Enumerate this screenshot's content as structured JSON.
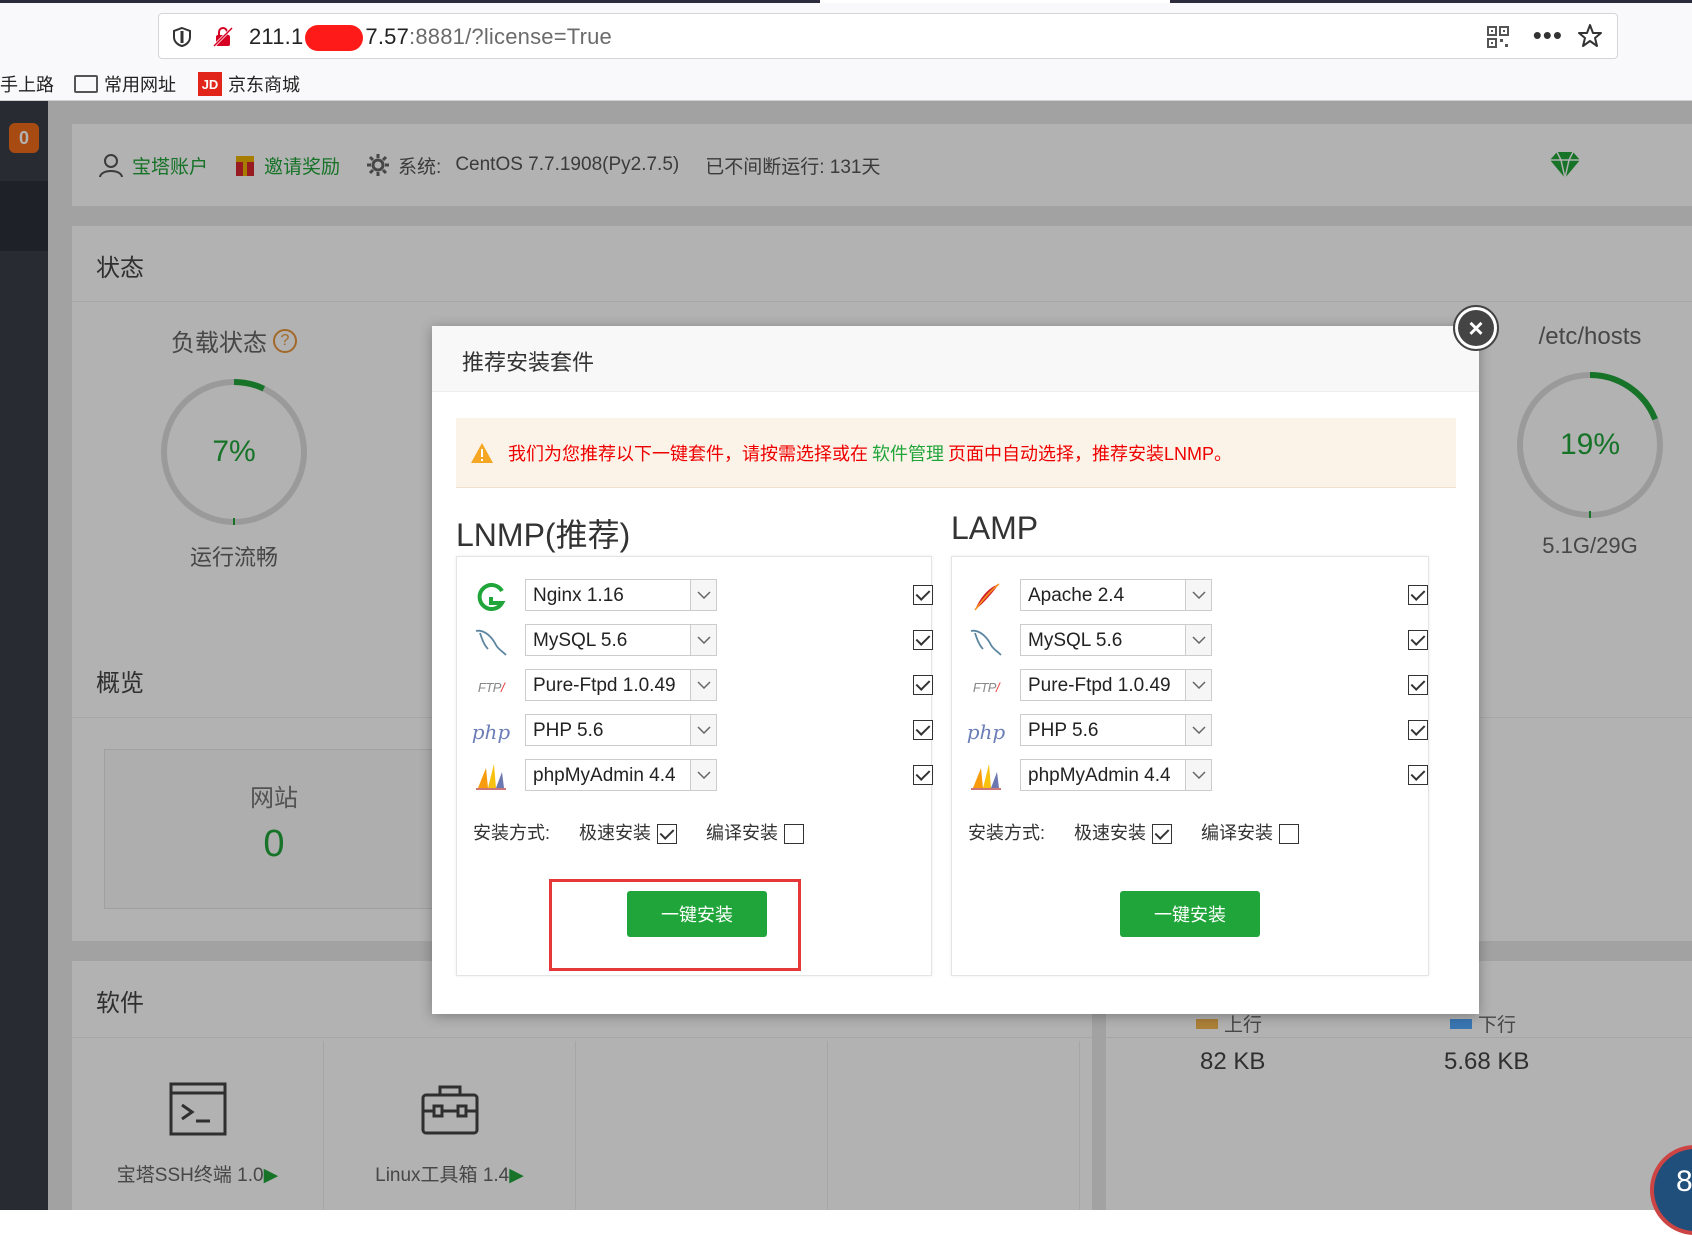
{
  "browser": {
    "url_prefix": "211.1",
    "url_mid": "7.57",
    "url_rest": ":8881/?license=True",
    "bookmarks": [
      "手上路",
      "常用网址",
      "京东商城"
    ],
    "jd_badge": "JD"
  },
  "sidebar": {
    "badge": "0"
  },
  "topinfo": {
    "account": "宝塔账户",
    "invite": "邀请奖励",
    "system_label": "系统:",
    "system_value": "CentOS 7.7.1908(Py2.7.5)",
    "uptime": "已不间断运行: 131天"
  },
  "status": {
    "title": "状态",
    "load": {
      "label": "负载状态",
      "help": "?",
      "percent": "7%",
      "value": 0.07,
      "sub": "运行流畅"
    },
    "disk": {
      "label": "/etc/hosts",
      "percent": "19%",
      "value": 0.19,
      "sub": "5.1G/29G"
    }
  },
  "overview": {
    "title": "概览",
    "site_label": "网站",
    "site_count": "0"
  },
  "software": {
    "title": "软件",
    "items": [
      {
        "name": "宝塔SSH终端 1.0",
        "arrow": "▶"
      },
      {
        "name": "Linux工具箱 1.4",
        "arrow": "▶"
      }
    ]
  },
  "traffic": {
    "up_label": "上行",
    "up_value": "82 KB",
    "down_label": "下行",
    "down_value": "5.68 KB"
  },
  "corner_widget": "8",
  "modal": {
    "title": "推荐安装套件",
    "close": "×",
    "alert_pre": "我们为您推荐以下一键套件，请按需选择或在",
    "alert_link": "软件管理",
    "alert_post": "页面中自动选择，推荐安装LNMP。",
    "lnmp": {
      "title": "LNMP(推荐)",
      "rows": [
        {
          "icon": "nginx-icon",
          "value": "Nginx 1.16",
          "checked": true
        },
        {
          "icon": "mysql-icon",
          "value": "MySQL 5.6",
          "checked": true
        },
        {
          "icon": "ftp-icon",
          "value": "Pure-Ftpd 1.0.49",
          "checked": true
        },
        {
          "icon": "php-icon",
          "value": "PHP 5.6",
          "checked": true
        },
        {
          "icon": "phpmyadmin-icon",
          "value": "phpMyAdmin 4.4",
          "checked": true
        }
      ],
      "method_label": "安装方式:",
      "fast_label": "极速安装",
      "fast_checked": true,
      "compile_label": "编译安装",
      "compile_checked": false,
      "button": "一键安装"
    },
    "lamp": {
      "title": "LAMP",
      "rows": [
        {
          "icon": "apache-icon",
          "value": "Apache 2.4",
          "checked": true
        },
        {
          "icon": "mysql-icon",
          "value": "MySQL 5.6",
          "checked": true
        },
        {
          "icon": "ftp-icon",
          "value": "Pure-Ftpd 1.0.49",
          "checked": true
        },
        {
          "icon": "php-icon",
          "value": "PHP 5.6",
          "checked": true
        },
        {
          "icon": "phpmyadmin-icon",
          "value": "phpMyAdmin 4.4",
          "checked": true
        }
      ],
      "method_label": "安装方式:",
      "fast_label": "极速安装",
      "fast_checked": true,
      "compile_label": "编译安装",
      "compile_checked": false,
      "button": "一键安装"
    },
    "ftp_text": "FTP",
    "php_text": "php"
  },
  "colors": {
    "accent": "#20a53a",
    "alert_text": "#ee0000",
    "highlight": "#e53838"
  }
}
